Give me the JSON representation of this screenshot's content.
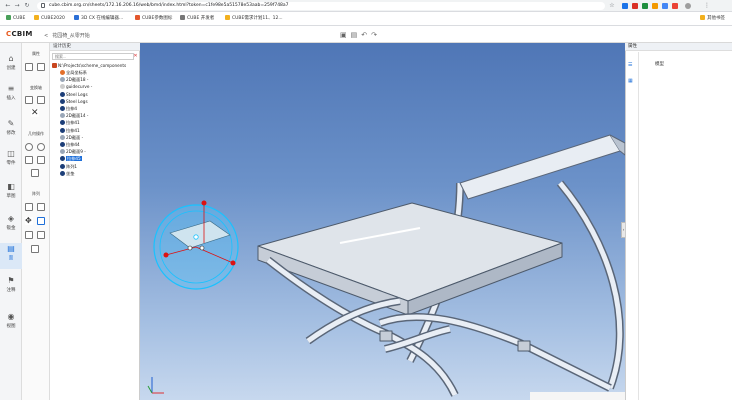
{
  "browser": {
    "url": "cube.cbim.org.cn/sheets/172.16.206.16/web/bmd/index.html?token=c1fe98e5a51578e53aab=259f748a7",
    "bookmarks": [
      {
        "label": "CUBE",
        "color": "#4aa05a"
      },
      {
        "label": "CUBE2020",
        "color": "#f2b01e"
      },
      {
        "label": "3D CX 在线编辑器...",
        "color": "#2b6fd6"
      },
      {
        "label": "CUBE参数图标",
        "color": "#e3572d"
      },
      {
        "label": "CUBE 开发者",
        "color": "#777777"
      },
      {
        "label": "CUBE需求计划11、12...",
        "color": "#f2b01e"
      }
    ],
    "bookmarks_right": "其他书签"
  },
  "app": {
    "logo_prefix": "C",
    "logo_text": "CBIM",
    "breadcrumb_sep": "<",
    "breadcrumb": "花园椅_从零开始"
  },
  "rail": {
    "items": [
      {
        "icon": "⌂",
        "label": "创建"
      },
      {
        "icon": "≡",
        "label": "插入"
      },
      {
        "icon": "✎",
        "label": "修改"
      },
      {
        "icon": "◫",
        "label": "零件"
      },
      {
        "icon": "◧",
        "label": "草图"
      },
      {
        "icon": "◈",
        "label": "钣金"
      },
      {
        "icon": "▤",
        "label": "面"
      },
      {
        "icon": "⚑",
        "label": "注释"
      },
      {
        "icon": "◉",
        "label": "视图"
      }
    ]
  },
  "tools": {
    "group1": "属性",
    "group2": "变换轴",
    "group3": "几何操作",
    "group4": "阵列"
  },
  "tree": {
    "title": "设计历史",
    "search_placeholder": "搜索...",
    "close": "✕",
    "root": "N:\\Projects\\scheme_components",
    "items": [
      {
        "label": "全局坐标系",
        "color": "#e36f2a",
        "indent": 1
      },
      {
        "label": "2D截面18 -",
        "color": "#9aa7b8",
        "indent": 1
      },
      {
        "label": "guidecurve -",
        "color": "#cccccc",
        "indent": 1
      },
      {
        "label": "Steel Legs",
        "color": "#1c3e78",
        "indent": 1
      },
      {
        "label": "Steel Legs",
        "color": "#1c3e78",
        "indent": 1
      },
      {
        "label": "拉伸4",
        "color": "#1c3e78",
        "indent": 1
      },
      {
        "label": "2D截面14 -",
        "color": "#9aa7b8",
        "indent": 1
      },
      {
        "label": "拉伸41",
        "color": "#1c3e78",
        "indent": 1
      },
      {
        "label": "拉伸41",
        "color": "#1c3e78",
        "indent": 1
      },
      {
        "label": "2D截面 -",
        "color": "#9aa7b8",
        "indent": 1
      },
      {
        "label": "拉伸44",
        "color": "#1c3e78",
        "indent": 1
      },
      {
        "label": "2D截面9 -",
        "color": "#9aa7b8",
        "indent": 1
      },
      {
        "label": "拉伸45",
        "color": "#1c3e78",
        "indent": 1,
        "selected": true
      },
      {
        "label": "阵列1",
        "color": "#1c3e78",
        "indent": 1
      },
      {
        "label": "坐垫",
        "color": "#1c3e78",
        "indent": 1
      }
    ]
  },
  "right": {
    "title": "属性",
    "subtitle": "模型"
  }
}
